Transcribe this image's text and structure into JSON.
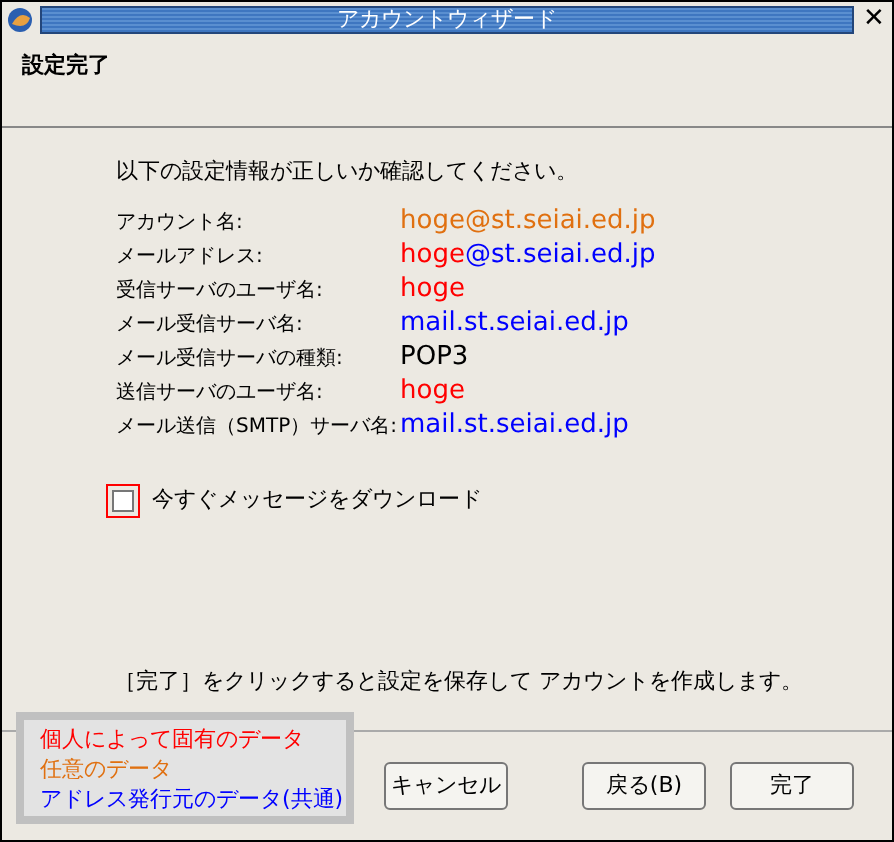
{
  "window": {
    "title": "アカウントウィザード",
    "close": "✕"
  },
  "heading": "設定完了",
  "intro": "以下の設定情報が正しいか確認してください。",
  "rows": [
    {
      "label": "アカウント名:",
      "value": [
        {
          "text": "hoge@st.seiai.ed.jp",
          "color": "#e07010"
        }
      ]
    },
    {
      "label": "メールアドレス:",
      "value": [
        {
          "text": "hoge",
          "color": "#ff0000"
        },
        {
          "text": "@st.seiai.ed.jp",
          "color": "#0000ff"
        }
      ]
    },
    {
      "label": "受信サーバのユーザ名:",
      "value": [
        {
          "text": "hoge",
          "color": "#ff0000"
        }
      ]
    },
    {
      "label": "メール受信サーバ名:",
      "value": [
        {
          "text": "mail.st.seiai.ed.jp",
          "color": "#0000ff"
        }
      ]
    },
    {
      "label": "メール受信サーバの種類:",
      "value": [
        {
          "text": "POP3",
          "color": "#000000"
        }
      ]
    },
    {
      "label": "送信サーバのユーザ名:",
      "value": [
        {
          "text": "hoge",
          "color": "#ff0000"
        }
      ]
    },
    {
      "label": "メール送信（SMTP）サーバ名:",
      "value": [
        {
          "text": "mail.st.seiai.ed.jp",
          "color": "#0000ff"
        }
      ]
    }
  ],
  "download_checkbox": {
    "label": "今すぐメッセージをダウンロード",
    "checked": false
  },
  "footer_note": "［完了］をクリックすると設定を保存して アカウントを作成します。",
  "buttons": [
    {
      "label": "キャンセル"
    },
    {
      "label": "戻る(B)"
    },
    {
      "label": "完了"
    }
  ],
  "legend": [
    {
      "text": "個人によって固有のデータ",
      "color": "#ff0000"
    },
    {
      "text": "任意のデータ",
      "color": "#e07010"
    },
    {
      "text": "アドレス発行元のデータ(共通)",
      "color": "#0000ff"
    }
  ]
}
